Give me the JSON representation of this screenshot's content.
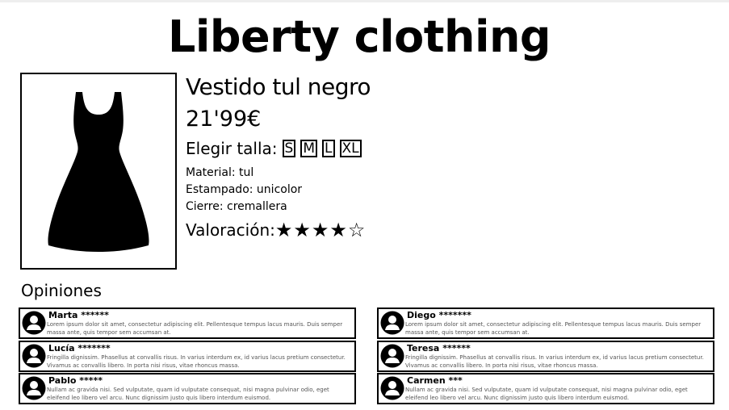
{
  "site": {
    "title": "Liberty clothing"
  },
  "product": {
    "name": "Vestido tul negro",
    "price": "21'99€",
    "size_label": "Elegir talla:",
    "sizes": [
      "S",
      "M",
      "L",
      "XL"
    ],
    "material": "Material: tul",
    "print": "Estampado: unicolor",
    "closure": "Cierre: cremallera",
    "rating_label": "Valoración:",
    "rating_stars": "★★★★☆",
    "rating_value": 4,
    "rating_max": 5,
    "image_icon": "dress-icon"
  },
  "opinions": {
    "title": "Opiniones",
    "reviews": [
      {
        "name": "Marta ******",
        "text": "Lorem ipsum dolor sit amet, consectetur adipiscing elit. Pellentesque tempus lacus mauris. Duis semper massa ante, quis tempor sem accumsan at.",
        "icon": "user-avatar-icon"
      },
      {
        "name": "Diego *******",
        "text": "Lorem ipsum dolor sit amet, consectetur adipiscing elit. Pellentesque tempus lacus mauris. Duis semper massa ante, quis tempor sem accumsan at.",
        "icon": "user-avatar-icon"
      },
      {
        "name": "Lucía *******",
        "text": "Fringilla dignissim. Phasellus at convallis risus. In varius interdum ex, id varius lacus pretium consectetur. Vivamus ac convallis libero. In porta nisi risus, vitae rhoncus massa.",
        "icon": "user-avatar-icon"
      },
      {
        "name": "Teresa ******",
        "text": "Fringilla dignissim. Phasellus at convallis risus. In varius interdum ex, id varius lacus pretium consectetur. Vivamus ac convallis libero. In porta nisi risus, vitae rhoncus massa.",
        "icon": "user-avatar-icon"
      },
      {
        "name": "Pablo *****",
        "text": "Nullam ac gravida nisi. Sed vulputate, quam id vulputate consequat, nisi magna pulvinar odio, eget eleifend leo libero vel arcu. Nunc dignissim justo quis libero interdum euismod.",
        "icon": "user-avatar-icon"
      },
      {
        "name": "Carmen ***",
        "text": "Nullam ac gravida nisi. Sed vulputate, quam id vulputate consequat, nisi magna pulvinar odio, eget eleifend leo libero vel arcu. Nunc dignissim justo quis libero interdum euismod.",
        "icon": "user-avatar-icon"
      }
    ]
  }
}
